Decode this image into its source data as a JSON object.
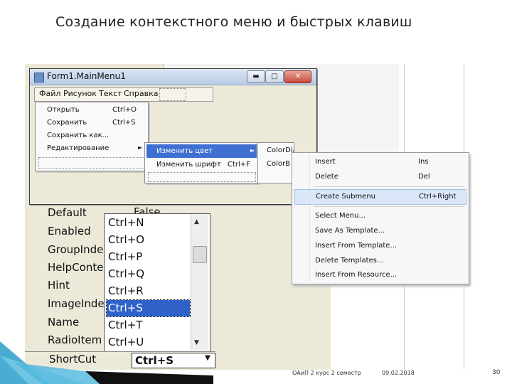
{
  "slide": {
    "title": "Создание контекстного меню и быстрых клавиш",
    "footer_left": "ОАиП 2 курс 2 семестр",
    "footer_date": "09.02.2018",
    "page_number": "30"
  },
  "form_window": {
    "title": "Form1.MainMenu1",
    "minimize": "▬",
    "maximize": "□",
    "close": "✕"
  },
  "menubar": {
    "items": [
      "Файл",
      "Рисунок",
      "Текст",
      "Справка"
    ]
  },
  "file_menu": {
    "items": [
      {
        "label": "Открыть",
        "shortcut": "Ctrl+O"
      },
      {
        "label": "Сохранить",
        "shortcut": "Ctrl+S"
      },
      {
        "label": "Сохранить как...",
        "shortcut": ""
      },
      {
        "label": "Редактирование",
        "shortcut": "",
        "arrow": "►"
      }
    ]
  },
  "edit_submenu": {
    "items": [
      {
        "label": "Изменить цвет",
        "shortcut": "",
        "arrow": "►"
      },
      {
        "label": "Изменить шрифт",
        "shortcut": "Ctrl+F",
        "arrow": ""
      }
    ]
  },
  "color_dialog": {
    "items": [
      "ColorDialog",
      "ColorB"
    ]
  },
  "context_menu": {
    "items": [
      {
        "label": "Insert",
        "shortcut": "Ins"
      },
      {
        "label": "Delete",
        "shortcut": "Del"
      },
      {
        "label": "Create Submenu",
        "shortcut": "Ctrl+Right"
      },
      {
        "label": "Select Menu...",
        "shortcut": ""
      },
      {
        "label": "Save As Template...",
        "shortcut": ""
      },
      {
        "label": "Insert From Template...",
        "shortcut": ""
      },
      {
        "label": "Delete Templates...",
        "shortcut": ""
      },
      {
        "label": "Insert From Resource...",
        "shortcut": ""
      }
    ]
  },
  "inspector": {
    "properties": [
      "Default",
      "Enabled",
      "GroupIndex",
      "HelpContext",
      "Hint",
      "ImageIndex",
      "Name",
      "RadioItem"
    ],
    "default_value": "False",
    "shortcut_property": "ShortCut",
    "shortcut_value": "Ctrl+S",
    "shortcut_list": [
      "Ctrl+N",
      "Ctrl+O",
      "Ctrl+P",
      "Ctrl+Q",
      "Ctrl+R",
      "Ctrl+S",
      "Ctrl+T",
      "Ctrl+U"
    ],
    "selected_shortcut": "Ctrl+S"
  },
  "colors": {
    "selection_blue": "#2f62c9",
    "submenu_highlight": "#3e6fd1",
    "context_hover": "#dbe7f8",
    "footer_accent": "#2a9ec8"
  }
}
